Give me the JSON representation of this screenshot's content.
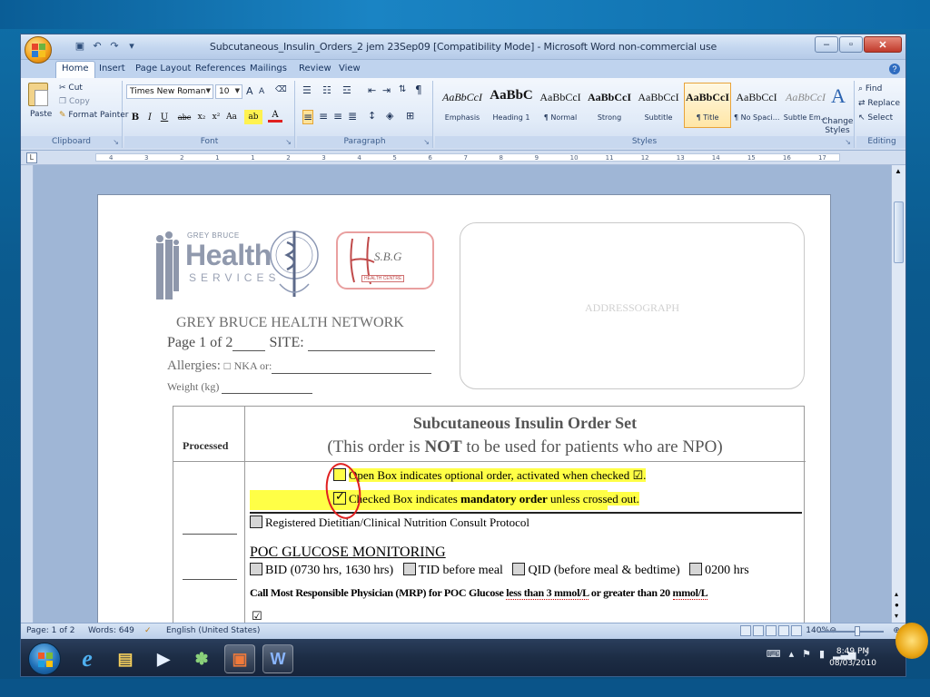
{
  "window": {
    "title": "Subcutaneous_Insulin_Orders_2 jem 23Sep09 [Compatibility Mode] - Microsoft Word non-commercial use",
    "controls": {
      "minimize": "–",
      "restore": "▫",
      "close": "✕"
    }
  },
  "ribbon_tabs": [
    "Home",
    "Insert",
    "Page Layout",
    "References",
    "Mailings",
    "Review",
    "View"
  ],
  "clipboard": {
    "paste": "Paste",
    "cut": "Cut",
    "copy": "Copy",
    "format_painter": "Format Painter",
    "label": "Clipboard"
  },
  "font": {
    "name": "Times New Roman",
    "size": "10",
    "label": "Font",
    "bold": "B",
    "italic": "I",
    "underline": "U",
    "strike": "abc",
    "sub": "x₂",
    "sup": "x²",
    "case": "Aa",
    "grow": "A",
    "shrink": "A"
  },
  "paragraph": {
    "label": "Paragraph"
  },
  "styles": {
    "label": "Styles",
    "items": [
      {
        "sample": "AaBbCcI",
        "name": "Emphasis"
      },
      {
        "sample": "AaBbC",
        "name": "Heading 1"
      },
      {
        "sample": "AaBbCcI",
        "name": "¶ Normal"
      },
      {
        "sample": "AaBbCcI",
        "name": "Strong"
      },
      {
        "sample": "AaBbCcI",
        "name": "Subtitle"
      },
      {
        "sample": "AaBbCcI",
        "name": "¶ Title"
      },
      {
        "sample": "AaBbCcI",
        "name": "¶ No Spaci..."
      },
      {
        "sample": "AaBbCcI",
        "name": "Subtle Em..."
      }
    ],
    "change_styles": "Change Styles"
  },
  "editing": {
    "find": "Find",
    "replace": "Replace",
    "select": "Select",
    "label": "Editing"
  },
  "ruler": {
    "numbers": [
      "4",
      "3",
      "2",
      "1",
      "1",
      "2",
      "3",
      "4",
      "5",
      "6",
      "7",
      "8",
      "9",
      "10",
      "11",
      "12",
      "13",
      "14",
      "15",
      "16",
      "17"
    ]
  },
  "document": {
    "logo": {
      "grey_bruce": "GREY BRUCE",
      "health": "Health",
      "services": "SERVICES"
    },
    "sbg": {
      "text": "S.B.G",
      "sub": "HEALTH CENTRE"
    },
    "addressograph": "ADDRESSOGRAPH",
    "network": "GREY BRUCE HEALTH NETWORK",
    "page_label": "Page 1 of 2",
    "site_label": "SITE:",
    "allergies_label": "Allergies:",
    "nka_label": "NKA or:",
    "weight_label": "Weight (kg)",
    "table": {
      "processed": "Processed",
      "title": "Subcutaneous Insulin Order Set",
      "subtitle_pre": "(This order is ",
      "subtitle_bold": "NOT",
      "subtitle_post": " to be used for patients who are NPO)",
      "open_box_text": "Open Box indicates optional order, activated when checked",
      "checked_box_pre": "Checked Box indicates ",
      "checked_box_bold": "mandatory  order",
      "checked_box_post": " unless crossed out.",
      "dietitian": "Registered Dietitian/Clinical Nutrition Consult Protocol",
      "poc_heading": "POC GLUCOSE MONITORING",
      "bid": "BID (0730 hrs, 1630 hrs)",
      "tid": "TID before meal",
      "qid": "QID (before meal & bedtime)",
      "h0200": "0200 hrs",
      "call_pre": "Call Most Responsible Physician (MRP) for POC Glucose ",
      "call_u1": "less  than 3 mmol/L",
      "call_mid": " or greater than 20 ",
      "call_u2": "mmol/L"
    }
  },
  "status": {
    "page": "Page: 1 of 2",
    "words": "Words: 649",
    "language": "English (United States)",
    "zoom": "140%"
  },
  "taskbar": {
    "time": "8:49 PM",
    "date": "08/03/2010"
  }
}
